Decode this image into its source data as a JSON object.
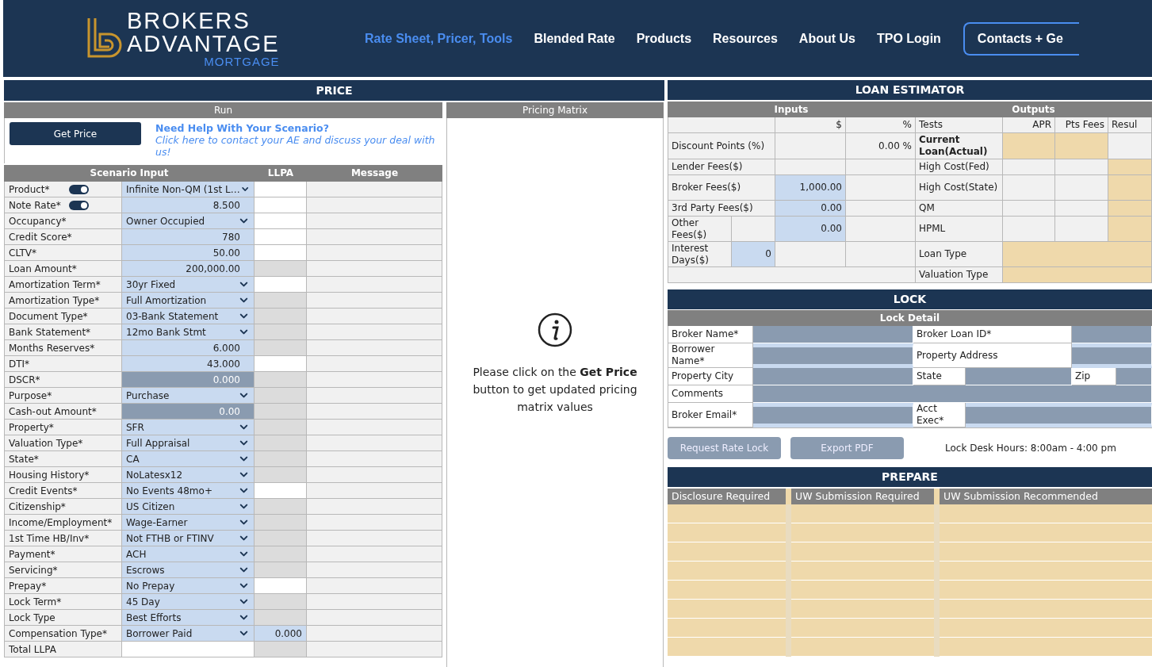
{
  "header": {
    "logo": {
      "line1": "BROKERS",
      "line2": "ADVANTAGE",
      "line3": "MORTGAGE"
    },
    "nav": [
      {
        "label": "Rate Sheet, Pricer, Tools",
        "selected": true
      },
      {
        "label": "Blended Rate",
        "selected": false
      },
      {
        "label": "Products",
        "selected": false
      },
      {
        "label": "Resources",
        "selected": false
      },
      {
        "label": "About Us",
        "selected": false
      },
      {
        "label": "TPO Login",
        "selected": false
      }
    ],
    "contact_button": "Contacts + Ge"
  },
  "price": {
    "title": "PRICE",
    "run": {
      "title": "Run",
      "button": "Get Price",
      "help_title": "Need Help With Your Scenario?",
      "help_text": "Click here to contact your AE and discuss your deal with us!"
    },
    "columns": [
      "Scenario Input",
      "LLPA",
      "Message"
    ],
    "rows": [
      {
        "label": "Product*",
        "value": "Infinite Non-QM (1st L…",
        "kind": "select",
        "llpa_shaded": false,
        "toggle": {
          "on": true
        }
      },
      {
        "label": "Note Rate*",
        "value": "8.500",
        "kind": "number",
        "llpa_shaded": false,
        "toggle": {
          "on": true
        }
      },
      {
        "label": "Occupancy*",
        "value": "Owner Occupied",
        "kind": "select",
        "llpa_shaded": false
      },
      {
        "label": "Credit Score*",
        "value": "780",
        "kind": "number",
        "llpa_shaded": false
      },
      {
        "label": "CLTV*",
        "value": "50.00",
        "kind": "number",
        "llpa_shaded": false
      },
      {
        "label": "Loan Amount*",
        "value": "200,000.00",
        "kind": "number",
        "llpa_shaded": true
      },
      {
        "label": "Amortization Term*",
        "value": "30yr Fixed",
        "kind": "select",
        "llpa_shaded": false
      },
      {
        "label": "Amortization Type*",
        "value": "Full Amortization",
        "kind": "select",
        "llpa_shaded": true
      },
      {
        "label": "Document Type*",
        "value": "03-Bank Statement",
        "kind": "select",
        "llpa_shaded": true
      },
      {
        "label": "Bank Statement*",
        "value": "12mo Bank Stmt",
        "kind": "select",
        "llpa_shaded": true
      },
      {
        "label": "Months Reserves*",
        "value": "6.000",
        "kind": "number",
        "llpa_shaded": true
      },
      {
        "label": "DTI*",
        "value": "43.000",
        "kind": "number",
        "llpa_shaded": false
      },
      {
        "label": "DSCR*",
        "value": "0.000",
        "kind": "disabled",
        "llpa_shaded": true
      },
      {
        "label": "Purpose*",
        "value": "Purchase",
        "kind": "select",
        "llpa_shaded": true
      },
      {
        "label": "Cash-out Amount*",
        "value": "0.00",
        "kind": "disabled",
        "llpa_shaded": true
      },
      {
        "label": "Property*",
        "value": "SFR",
        "kind": "select",
        "llpa_shaded": true
      },
      {
        "label": "Valuation Type*",
        "value": "Full Appraisal",
        "kind": "select",
        "llpa_shaded": true
      },
      {
        "label": "State*",
        "value": "CA",
        "kind": "select",
        "llpa_shaded": true
      },
      {
        "label": "Housing History*",
        "value": "NoLatesx12",
        "kind": "select",
        "llpa_shaded": true
      },
      {
        "label": "Credit Events*",
        "value": "No Events 48mo+",
        "kind": "select",
        "llpa_shaded": false
      },
      {
        "label": "Citizenship*",
        "value": "US Citizen",
        "kind": "select",
        "llpa_shaded": true
      },
      {
        "label": "Income/Employment*",
        "value": "Wage-Earner",
        "kind": "select",
        "llpa_shaded": true
      },
      {
        "label": "1st Time HB/Inv*",
        "value": "Not FTHB or FTINV",
        "kind": "select",
        "llpa_shaded": true
      },
      {
        "label": "Payment*",
        "value": "ACH",
        "kind": "select",
        "llpa_shaded": true
      },
      {
        "label": "Servicing*",
        "value": "Escrows",
        "kind": "select",
        "llpa_shaded": true
      },
      {
        "label": "Prepay*",
        "value": "No Prepay",
        "kind": "select",
        "llpa_shaded": false
      },
      {
        "label": "Lock Term*",
        "value": "45 Day",
        "kind": "select",
        "llpa_shaded": true
      },
      {
        "label": "Lock Type",
        "value": "Best Efforts",
        "kind": "select",
        "llpa_shaded": true
      },
      {
        "label": "Compensation Type*",
        "value": "Borrower Paid",
        "kind": "select",
        "llpa": "0.000"
      },
      {
        "label": "Total LLPA",
        "kind": "total",
        "llpa_shaded": true
      }
    ],
    "matrix": {
      "title": "Pricing Matrix",
      "message": "Please click on the **Get Price** button to get updated pricing matrix values"
    }
  },
  "estimator": {
    "title": "LOAN ESTIMATOR",
    "inputs": {
      "title": "Inputs",
      "columns": [
        "$",
        "%"
      ],
      "rows": [
        {
          "kind": "plain",
          "label": "Discount Points (%)",
          "cells": [
            {
              "editable": false
            },
            {
              "text": "0.00 %",
              "editable": false
            }
          ]
        },
        {
          "kind": "plain",
          "label": "Lender Fees($)",
          "cells": [
            {
              "editable": false
            },
            {
              "editable": false
            }
          ]
        },
        {
          "kind": "plain",
          "label": "Broker Fees($)",
          "cells": [
            {
              "text": "1,000.00",
              "editable": true
            },
            {
              "editable": false
            }
          ]
        },
        {
          "kind": "plain",
          "label": "3rd Party Fees($)",
          "cells": [
            {
              "text": "0.00",
              "editable": true
            },
            {
              "editable": false
            }
          ]
        },
        {
          "kind": "split",
          "label": "Other Fees($)",
          "extra": {
            "editable": false
          },
          "cells": [
            {
              "text": "0.00",
              "editable": true
            },
            {
              "editable": false
            }
          ]
        },
        {
          "kind": "split",
          "label": "Interest Days($)",
          "extra": {
            "text": "0",
            "editable": true
          },
          "cells": [
            {
              "editable": false
            },
            {
              "editable": false
            }
          ]
        }
      ]
    },
    "outputs": {
      "title": "Outputs",
      "columns": [
        "Tests",
        "APR",
        "Pts Fees",
        "Resul"
      ],
      "rows": [
        {
          "kind": "triple",
          "label": "Current Loan(Actual)",
          "bold": true,
          "cells": [
            {
              "highlighted": true
            },
            {
              "highlighted": true
            },
            {
              "highlighted": false
            }
          ]
        },
        {
          "kind": "triple",
          "label": "High Cost(Fed)",
          "bold": false,
          "cells": [
            {
              "highlighted": false
            },
            {
              "highlighted": false
            },
            {
              "highlighted": true
            }
          ]
        },
        {
          "kind": "triple",
          "label": "High Cost(State)",
          "bold": false,
          "cells": [
            {
              "highlighted": false
            },
            {
              "highlighted": false
            },
            {
              "highlighted": true
            }
          ]
        },
        {
          "kind": "triple",
          "label": "QM",
          "bold": false,
          "cells": [
            {
              "highlighted": false
            },
            {
              "highlighted": false
            },
            {
              "highlighted": true
            }
          ]
        },
        {
          "kind": "triple",
          "label": "HPML",
          "bold": false,
          "cells": [
            {
              "highlighted": false
            },
            {
              "highlighted": false
            },
            {
              "highlighted": true
            }
          ]
        },
        {
          "kind": "wide",
          "label": "Loan Type",
          "bold": false,
          "cells": [
            {
              "highlighted": true
            }
          ]
        },
        {
          "kind": "wide",
          "label": "Valuation Type",
          "bold": false,
          "cells": [
            {
              "highlighted": true
            }
          ]
        }
      ]
    }
  },
  "lock": {
    "title": "LOCK",
    "subtitle": "Lock Detail",
    "rows": [
      {
        "kind": "pair",
        "items": [
          {
            "label": "Broker Name*",
            "multiline": false
          },
          {
            "label": "Broker Loan ID*",
            "multiline": false
          }
        ]
      },
      {
        "kind": "pair",
        "items": [
          {
            "label": "Borrower Name*",
            "multiline": true
          },
          {
            "label": "Property Address",
            "multiline": true
          }
        ]
      },
      {
        "kind": "triple",
        "items": [
          {
            "label": "Property City",
            "multiline": false
          },
          {
            "label": "State",
            "multiline": false
          },
          {
            "label": "Zip",
            "multiline": false
          }
        ]
      },
      {
        "kind": "wide",
        "items": [
          {
            "label": "Comments",
            "multiline": false
          }
        ]
      },
      {
        "kind": "pair_short",
        "items": [
          {
            "label": "Broker Email*",
            "multiline": true
          },
          {
            "label": "Acct Exec*",
            "multiline": true
          }
        ]
      }
    ],
    "buttons": [
      {
        "label": "Request Rate Lock",
        "disabled": true
      },
      {
        "label": "Export PDF",
        "disabled": true
      }
    ],
    "hours": "Lock Desk Hours: 8:00am - 4:00 pm"
  },
  "prepare": {
    "title": "PREPARE",
    "columns": [
      "Disclosure Required",
      "UW Submission Required",
      "UW Submission Recommended"
    ]
  }
}
